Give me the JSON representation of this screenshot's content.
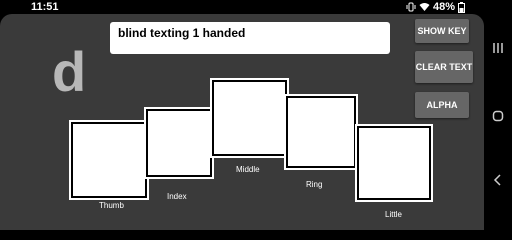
{
  "status_bar": {
    "time": "11:51",
    "battery_text": "48%"
  },
  "input": {
    "value": "blind texting 1 handed"
  },
  "current_letter": "d",
  "buttons": {
    "show_key": "SHOW KEY",
    "clear_text": "CLEAR TEXT",
    "alpha": "ALPHA"
  },
  "fingers": {
    "thumb": "Thumb",
    "index": "Index",
    "middle": "Middle",
    "ring": "Ring",
    "little": "Little"
  },
  "icons": [
    "vibrate-icon",
    "wifi-icon",
    "battery-icon",
    "recents-icon",
    "home-icon",
    "back-icon"
  ]
}
